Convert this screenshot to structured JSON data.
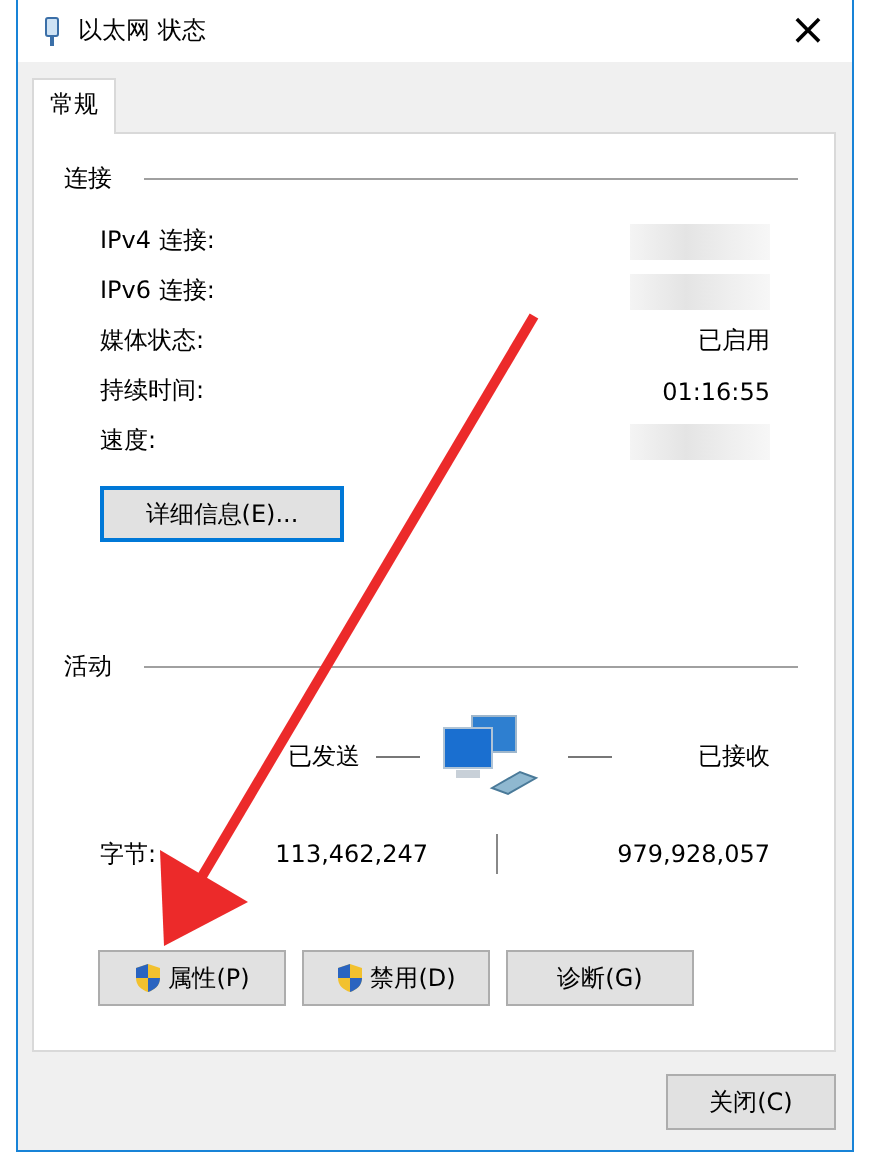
{
  "window": {
    "title": "以太网 状态",
    "close": "×"
  },
  "tabs": [
    {
      "label": "常规",
      "selected": true
    }
  ],
  "connection": {
    "heading": "连接",
    "rows": [
      {
        "label": "IPv4 连接:",
        "redacted": true
      },
      {
        "label": "IPv6 连接:",
        "redacted": true
      },
      {
        "label": "媒体状态:",
        "value": "已启用",
        "redacted": false
      },
      {
        "label": "持续时间:",
        "value": "01:16:55",
        "redacted": false
      },
      {
        "label": "速度:",
        "redacted": true
      }
    ],
    "details_button": "详细信息(E)..."
  },
  "activity": {
    "heading": "活动",
    "sent_label": "已发送",
    "received_label": "已接收",
    "bytes_label": "字节:",
    "bytes_sent": "113,462,247",
    "bytes_received": "979,928,057"
  },
  "actions": [
    {
      "label": "属性(P)",
      "shield": true
    },
    {
      "label": "禁用(D)",
      "shield": true
    },
    {
      "label": "诊断(G)",
      "shield": false
    }
  ],
  "close_button": "关闭(C)"
}
